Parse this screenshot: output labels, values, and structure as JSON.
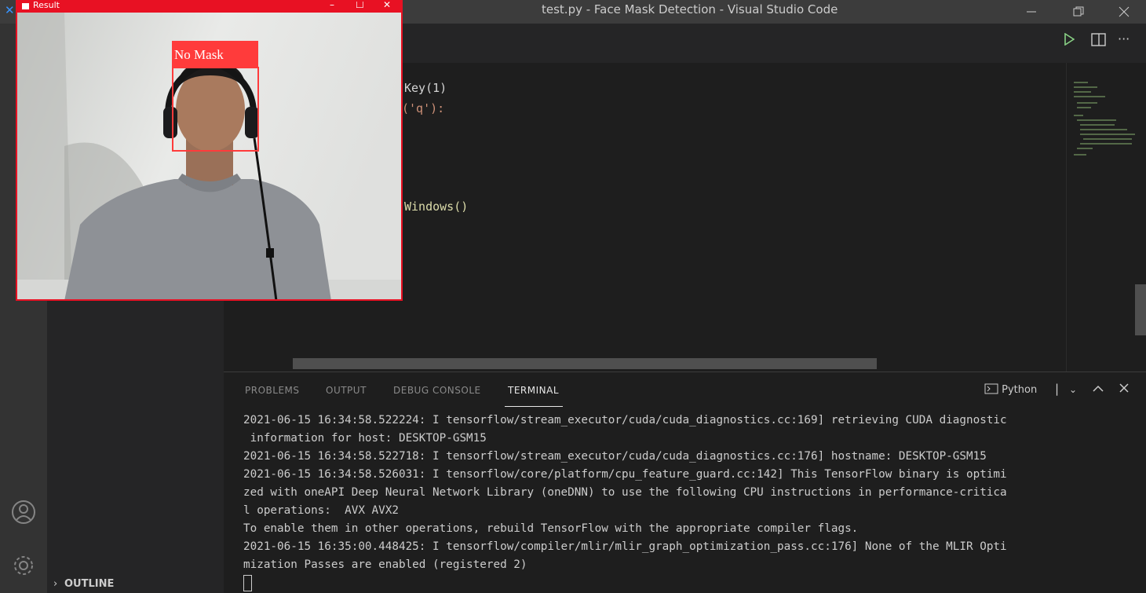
{
  "window": {
    "title": "test.py - Face Mask Detection - Visual Studio Code"
  },
  "editor": {
    "visible_code_fragments": [
      {
        "text": "Key(1)"
      },
      {
        "text": "('q'):"
      },
      {
        "text": "Windows()"
      }
    ]
  },
  "panel": {
    "tabs": [
      {
        "label": "PROBLEMS",
        "active": false
      },
      {
        "label": "OUTPUT",
        "active": false
      },
      {
        "label": "DEBUG CONSOLE",
        "active": false
      },
      {
        "label": "TERMINAL",
        "active": true
      }
    ],
    "shell_label": "Python",
    "terminal_lines": [
      "2021-06-15 16:34:58.522224: I tensorflow/stream_executor/cuda/cuda_diagnostics.cc:169] retrieving CUDA diagnostic",
      " information for host: DESKTOP-GSM15",
      "2021-06-15 16:34:58.522718: I tensorflow/stream_executor/cuda/cuda_diagnostics.cc:176] hostname: DESKTOP-GSM15",
      "2021-06-15 16:34:58.526031: I tensorflow/core/platform/cpu_feature_guard.cc:142] This TensorFlow binary is optimi",
      "zed with oneAPI Deep Neural Network Library (oneDNN) to use the following CPU instructions in performance-critica",
      "l operations:  AVX AVX2",
      "To enable them in other operations, rebuild TensorFlow with the appropriate compiler flags.",
      "2021-06-15 16:35:00.448425: I tensorflow/compiler/mlir/mlir_graph_optimization_pass.cc:176] None of the MLIR Opti",
      "mization Passes are enabled (registered 2)"
    ]
  },
  "sidebar": {
    "outline_label": "OUTLINE"
  },
  "camera_window": {
    "title": "Result",
    "detection_label": "No Mask"
  },
  "colors": {
    "detection_red": "#ff3b3b",
    "window_red": "#e81123",
    "run_green": "#89d185"
  }
}
